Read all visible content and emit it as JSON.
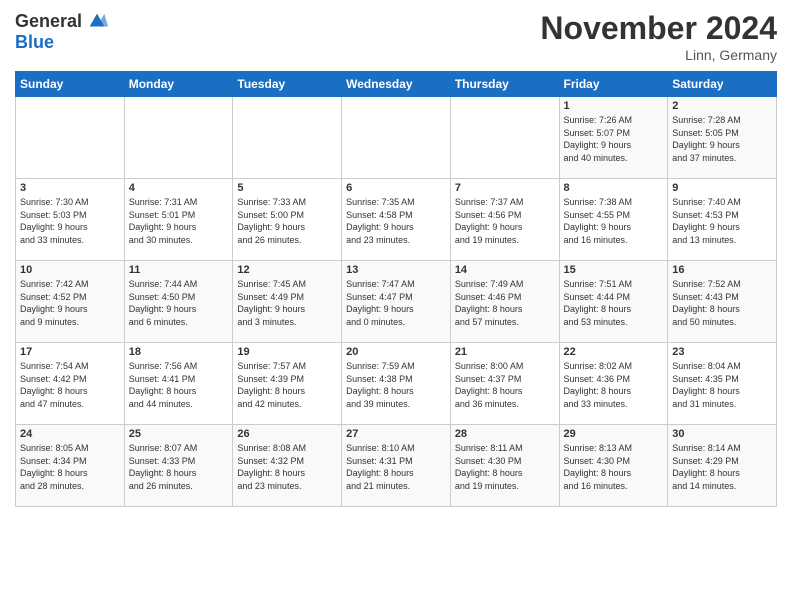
{
  "logo": {
    "general": "General",
    "blue": "Blue"
  },
  "header": {
    "title": "November 2024",
    "location": "Linn, Germany"
  },
  "weekdays": [
    "Sunday",
    "Monday",
    "Tuesday",
    "Wednesday",
    "Thursday",
    "Friday",
    "Saturday"
  ],
  "weeks": [
    [
      {
        "day": "",
        "info": ""
      },
      {
        "day": "",
        "info": ""
      },
      {
        "day": "",
        "info": ""
      },
      {
        "day": "",
        "info": ""
      },
      {
        "day": "",
        "info": ""
      },
      {
        "day": "1",
        "info": "Sunrise: 7:26 AM\nSunset: 5:07 PM\nDaylight: 9 hours\nand 40 minutes."
      },
      {
        "day": "2",
        "info": "Sunrise: 7:28 AM\nSunset: 5:05 PM\nDaylight: 9 hours\nand 37 minutes."
      }
    ],
    [
      {
        "day": "3",
        "info": "Sunrise: 7:30 AM\nSunset: 5:03 PM\nDaylight: 9 hours\nand 33 minutes."
      },
      {
        "day": "4",
        "info": "Sunrise: 7:31 AM\nSunset: 5:01 PM\nDaylight: 9 hours\nand 30 minutes."
      },
      {
        "day": "5",
        "info": "Sunrise: 7:33 AM\nSunset: 5:00 PM\nDaylight: 9 hours\nand 26 minutes."
      },
      {
        "day": "6",
        "info": "Sunrise: 7:35 AM\nSunset: 4:58 PM\nDaylight: 9 hours\nand 23 minutes."
      },
      {
        "day": "7",
        "info": "Sunrise: 7:37 AM\nSunset: 4:56 PM\nDaylight: 9 hours\nand 19 minutes."
      },
      {
        "day": "8",
        "info": "Sunrise: 7:38 AM\nSunset: 4:55 PM\nDaylight: 9 hours\nand 16 minutes."
      },
      {
        "day": "9",
        "info": "Sunrise: 7:40 AM\nSunset: 4:53 PM\nDaylight: 9 hours\nand 13 minutes."
      }
    ],
    [
      {
        "day": "10",
        "info": "Sunrise: 7:42 AM\nSunset: 4:52 PM\nDaylight: 9 hours\nand 9 minutes."
      },
      {
        "day": "11",
        "info": "Sunrise: 7:44 AM\nSunset: 4:50 PM\nDaylight: 9 hours\nand 6 minutes."
      },
      {
        "day": "12",
        "info": "Sunrise: 7:45 AM\nSunset: 4:49 PM\nDaylight: 9 hours\nand 3 minutes."
      },
      {
        "day": "13",
        "info": "Sunrise: 7:47 AM\nSunset: 4:47 PM\nDaylight: 9 hours\nand 0 minutes."
      },
      {
        "day": "14",
        "info": "Sunrise: 7:49 AM\nSunset: 4:46 PM\nDaylight: 8 hours\nand 57 minutes."
      },
      {
        "day": "15",
        "info": "Sunrise: 7:51 AM\nSunset: 4:44 PM\nDaylight: 8 hours\nand 53 minutes."
      },
      {
        "day": "16",
        "info": "Sunrise: 7:52 AM\nSunset: 4:43 PM\nDaylight: 8 hours\nand 50 minutes."
      }
    ],
    [
      {
        "day": "17",
        "info": "Sunrise: 7:54 AM\nSunset: 4:42 PM\nDaylight: 8 hours\nand 47 minutes."
      },
      {
        "day": "18",
        "info": "Sunrise: 7:56 AM\nSunset: 4:41 PM\nDaylight: 8 hours\nand 44 minutes."
      },
      {
        "day": "19",
        "info": "Sunrise: 7:57 AM\nSunset: 4:39 PM\nDaylight: 8 hours\nand 42 minutes."
      },
      {
        "day": "20",
        "info": "Sunrise: 7:59 AM\nSunset: 4:38 PM\nDaylight: 8 hours\nand 39 minutes."
      },
      {
        "day": "21",
        "info": "Sunrise: 8:00 AM\nSunset: 4:37 PM\nDaylight: 8 hours\nand 36 minutes."
      },
      {
        "day": "22",
        "info": "Sunrise: 8:02 AM\nSunset: 4:36 PM\nDaylight: 8 hours\nand 33 minutes."
      },
      {
        "day": "23",
        "info": "Sunrise: 8:04 AM\nSunset: 4:35 PM\nDaylight: 8 hours\nand 31 minutes."
      }
    ],
    [
      {
        "day": "24",
        "info": "Sunrise: 8:05 AM\nSunset: 4:34 PM\nDaylight: 8 hours\nand 28 minutes."
      },
      {
        "day": "25",
        "info": "Sunrise: 8:07 AM\nSunset: 4:33 PM\nDaylight: 8 hours\nand 26 minutes."
      },
      {
        "day": "26",
        "info": "Sunrise: 8:08 AM\nSunset: 4:32 PM\nDaylight: 8 hours\nand 23 minutes."
      },
      {
        "day": "27",
        "info": "Sunrise: 8:10 AM\nSunset: 4:31 PM\nDaylight: 8 hours\nand 21 minutes."
      },
      {
        "day": "28",
        "info": "Sunrise: 8:11 AM\nSunset: 4:30 PM\nDaylight: 8 hours\nand 19 minutes."
      },
      {
        "day": "29",
        "info": "Sunrise: 8:13 AM\nSunset: 4:30 PM\nDaylight: 8 hours\nand 16 minutes."
      },
      {
        "day": "30",
        "info": "Sunrise: 8:14 AM\nSunset: 4:29 PM\nDaylight: 8 hours\nand 14 minutes."
      }
    ]
  ]
}
